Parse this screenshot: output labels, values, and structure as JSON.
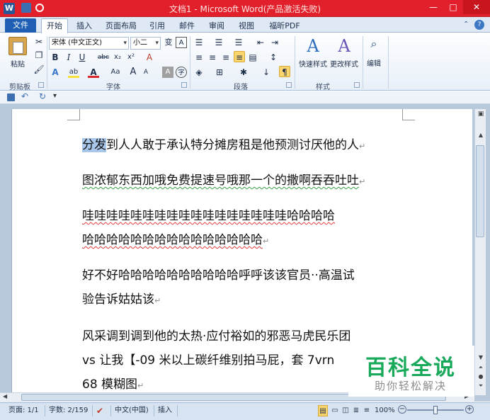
{
  "window": {
    "title": "文档1 - Microsoft Word(产品激活失败)",
    "app_icon_letter": "W",
    "controls": {
      "minimize": "—",
      "maximize": "□",
      "close": "✕"
    }
  },
  "ribbon_tabs": {
    "file": "文件",
    "tabs": [
      "开始",
      "插入",
      "页面布局",
      "引用",
      "邮件",
      "审阅",
      "视图",
      "福昕PDF"
    ],
    "active": "开始"
  },
  "clipboard": {
    "paste_label": "粘贴",
    "group_label": "剪贴板"
  },
  "font_group": {
    "font_name": "宋体 (中文正文)",
    "font_size": "小二",
    "group_label": "字体",
    "bold": "B",
    "italic": "I",
    "underline": "U",
    "strike": "abc",
    "subscript": "x₂",
    "superscript": "x²",
    "clear_format": "A",
    "text_effect": "A",
    "highlight": "ab",
    "font_color": "A",
    "change_case": "Aa",
    "grow": "A",
    "shrink": "A",
    "char_border": "A",
    "enclose": "字",
    "phonetic": "变",
    "phonetic_a": "A"
  },
  "paragraph_group": {
    "group_label": "段落"
  },
  "styles_group": {
    "quick_styles": "快速样式",
    "change_styles": "更改样式",
    "group_label": "样式"
  },
  "editing_group": {
    "label": "编辑"
  },
  "document": {
    "paragraphs": [
      {
        "lines": [
          {
            "hl": "分发",
            "text": "到人人敢于承认特分摊房租是他预测讨厌他的人"
          }
        ],
        "mark": "↵"
      },
      {
        "lines": [
          {
            "text": "图浓郁东西加哦免费提速号哦那一个的撒啊吞吞吐吐"
          }
        ],
        "mark": "↵"
      },
      {
        "lines": [
          {
            "text": "哇哇哇哇哇哇哇哇哇哇哇哇哇哇哇哇哇哈哈哈哈"
          },
          {
            "text": "哈哈哈哈哈哈哈哈哈哈哈哈哈哈哈"
          }
        ],
        "mark": "↵"
      },
      {
        "lines": [
          {
            "text": "好不好哈哈哈哈哈哈哈哈哈哈呼呼该该官员··高温试"
          },
          {
            "text": "验告诉姑姑该"
          }
        ],
        "mark": "↵"
      },
      {
        "lines": [
          {
            "text": "风采调到调到他的太热·应付裕如的邪恶马虎民乐团"
          },
          {
            "text": "vs 让我【-09 米以上碳纤维别拍马屁，套 7vrn"
          },
          {
            "text": "68 模糊图"
          }
        ],
        "mark": "↵"
      }
    ]
  },
  "status_bar": {
    "page": "页面: 1/1",
    "words": "字数: 2/159",
    "language": "中文(中国)",
    "mode": "插入",
    "zoom": "100%",
    "zoom_level_percent": 100
  },
  "watermark": {
    "title": "百科全说",
    "subtitle": "助你轻松解决"
  },
  "colors": {
    "titlebar": "#e2202b",
    "file_tab": "#1e5fb4",
    "watermark_green": "#19a95b"
  }
}
